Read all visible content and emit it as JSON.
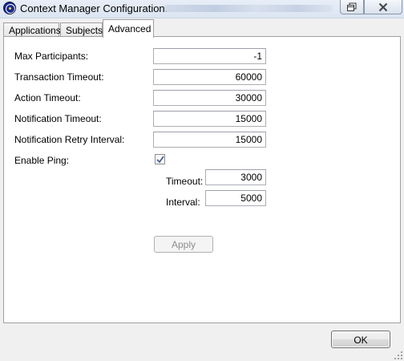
{
  "window": {
    "title": "Context Manager Configuration."
  },
  "tabs": [
    {
      "label": "Applications",
      "selected": false
    },
    {
      "label": "Subjects",
      "selected": false
    },
    {
      "label": "Advanced",
      "selected": true
    }
  ],
  "advanced": {
    "max_participants": {
      "label": "Max Participants:",
      "value": "-1"
    },
    "transaction_timeout": {
      "label": "Transaction Timeout:",
      "value": "60000"
    },
    "action_timeout": {
      "label": "Action Timeout:",
      "value": "30000"
    },
    "notification_timeout": {
      "label": "Notification Timeout:",
      "value": "15000"
    },
    "notification_retry_interval": {
      "label": "Notification Retry Interval:",
      "value": "15000"
    },
    "enable_ping": {
      "label": "Enable Ping:",
      "checked": true
    },
    "ping_timeout": {
      "label": "Timeout:",
      "value": "3000"
    },
    "ping_interval": {
      "label": "Interval:",
      "value": "5000"
    },
    "apply_label": "Apply",
    "apply_enabled": false
  },
  "footer": {
    "ok_label": "OK"
  },
  "icons": {
    "app": "app-logo-icon",
    "restore": "restore-window-icon",
    "close": "close-window-icon",
    "check": "checkmark-icon",
    "grip": "resize-grip-icon"
  },
  "colors": {
    "window_bg": "#f0f0f0",
    "panel_bg": "#ffffff",
    "checkmark": "#4a5f97",
    "disabled_text": "#8d8d8d"
  }
}
